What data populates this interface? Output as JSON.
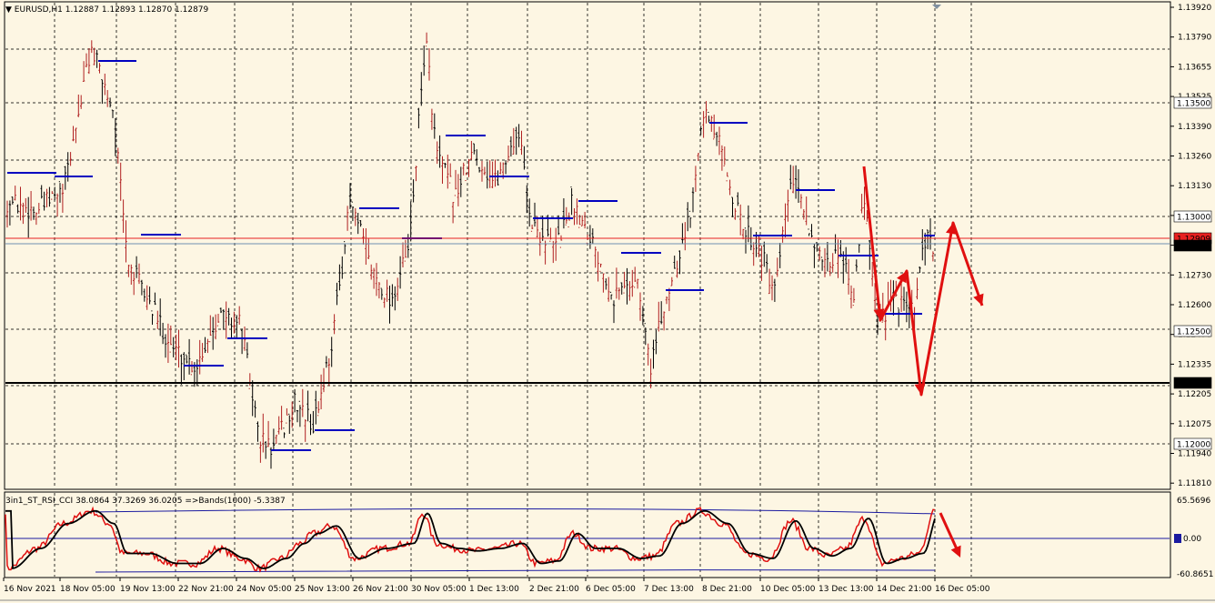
{
  "chart_header": {
    "symbol_label": "EURUSD,H1",
    "ohlc": "1.12887 1.12893 1.12870 1.12879"
  },
  "indicator_header": {
    "name": "3in1_ST_RSI_CCI",
    "values": "38.0864 37.3269 36.0205",
    "bands": "=>Bands(1000) -5.3387"
  },
  "price_axis": {
    "ticks": [
      "1.13920",
      "1.13790",
      "1.13655",
      "1.13525",
      "1.13390",
      "1.13260",
      "1.13130",
      "1.12995",
      "1.12865",
      "1.12730",
      "1.12600",
      "1.12470",
      "1.12335",
      "1.12205",
      "1.12075",
      "1.11940",
      "1.11810"
    ],
    "highlighted_levels": [
      {
        "label": "1.13500",
        "bg": "#ffffff",
        "fg": "#000000"
      },
      {
        "label": "1.13000",
        "bg": "#ffffff",
        "fg": "#000000"
      },
      {
        "label": "1.12909",
        "bg": "#e82020",
        "fg": "#ffffff"
      },
      {
        "label": "1.12879",
        "bg": "#000000",
        "fg": "#ffffff"
      },
      {
        "label": "1.12500",
        "bg": "#ffffff",
        "fg": "#000000"
      },
      {
        "label": "1.12274",
        "bg": "#000000",
        "fg": "#ffffff"
      },
      {
        "label": "1.12000",
        "bg": "#ffffff",
        "fg": "#000000"
      }
    ]
  },
  "indicator_axis": {
    "top": "65.5696",
    "mid": "0.00",
    "bottom": "-60.8651"
  },
  "time_axis": [
    "16 Nov 2021",
    "18 Nov 05:00",
    "19 Nov 13:00",
    "22 Nov 21:00",
    "24 Nov 05:00",
    "25 Nov 13:00",
    "26 Nov 21:00",
    "30 Nov 05:00",
    "1 Dec 13:00",
    "2 Dec 21:00",
    "6 Dec 05:00",
    "7 Dec 13:00",
    "8 Dec 21:00",
    "10 Dec 05:00",
    "13 Dec 13:00",
    "14 Dec 21:00",
    "16 Dec 05:00"
  ],
  "colors": {
    "background": "#fdf6e3",
    "bull_bar": "#b02020",
    "grid": "#000000",
    "level_line": "#0000c0",
    "current_price_line": "#e82020",
    "arrow": "#e01010"
  }
}
